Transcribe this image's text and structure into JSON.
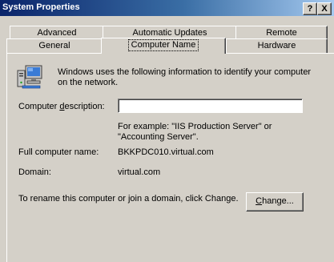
{
  "window": {
    "title": "System Properties",
    "help_label": "?",
    "close_label": "X"
  },
  "tabs": {
    "row1": [
      "Advanced",
      "Automatic Updates",
      "Remote"
    ],
    "row2": [
      "General",
      "Computer Name",
      "Hardware"
    ],
    "active": "Computer Name"
  },
  "panel": {
    "intro": "Windows uses the following information to identify your computer on the network.",
    "description_label": "Computer description:",
    "description_value": "",
    "example": "For example: \"IIS Production Server\" or \"Accounting Server\".",
    "full_name_label": "Full computer name:",
    "full_name_value": "BKKPDC010.virtual.com",
    "domain_label": "Domain:",
    "domain_value": "virtual.com",
    "rename_text": "To rename this computer or join a domain, click Change.",
    "change_button": "Change..."
  },
  "icons": {
    "computer": "computer-icon"
  },
  "colors": {
    "titlebar_start": "#0a246a",
    "titlebar_end": "#a6caf0",
    "face": "#d4d0c8"
  }
}
